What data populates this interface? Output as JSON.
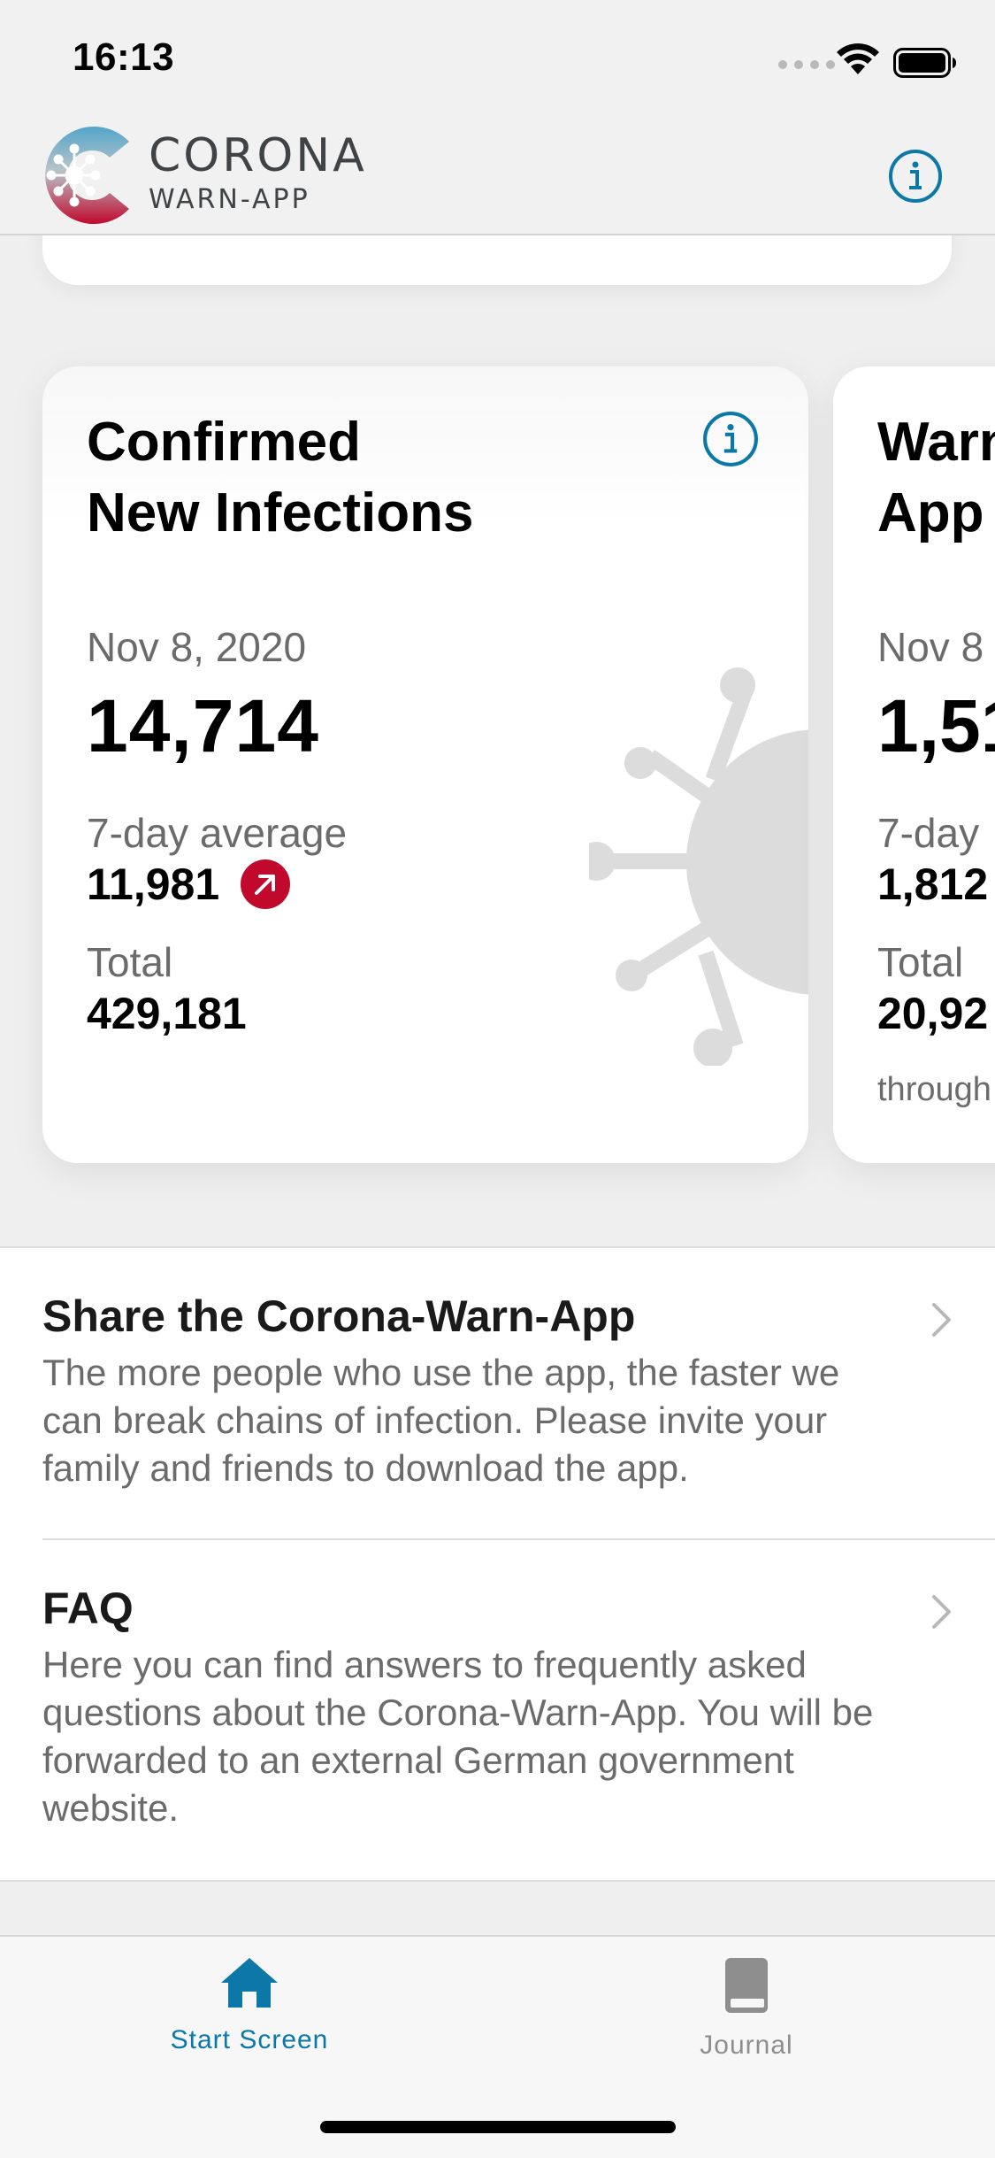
{
  "status_bar": {
    "time": "16:13"
  },
  "header": {
    "logo_title": "CORONA",
    "logo_subtitle": "WARN-APP",
    "info_icon": "info-circle-icon"
  },
  "cards": [
    {
      "title_line1": "Confirmed",
      "title_line2": "New Infections",
      "date": "Nov 8, 2020",
      "value": "14,714",
      "avg_label": "7-day average",
      "avg_value": "11,981",
      "trend": "up",
      "total_label": "Total",
      "total_value": "429,181"
    },
    {
      "title_line1": "Warn",
      "title_line2": "App",
      "date": "Nov 8",
      "value": "1,51",
      "avg_label": "7-day",
      "avg_value": "1,812",
      "total_label": "Total",
      "total_value": "20,92",
      "footnote": "through"
    }
  ],
  "list": [
    {
      "title": "Share the Corona-Warn-App",
      "body": "The more people who use the app, the faster we can break chains of infection. Please invite your family and friends to download the app."
    },
    {
      "title": "FAQ",
      "body": "Here you can find answers to frequently asked questions about the Corona-Warn-App. You will be forwarded to an external German government website."
    }
  ],
  "tabbar": {
    "home_label": "Start Screen",
    "journal_label": "Journal"
  },
  "colors": {
    "accent": "#0b78a8",
    "trend_up": "#c1092d",
    "secondary_text": "#6b6b6b"
  }
}
